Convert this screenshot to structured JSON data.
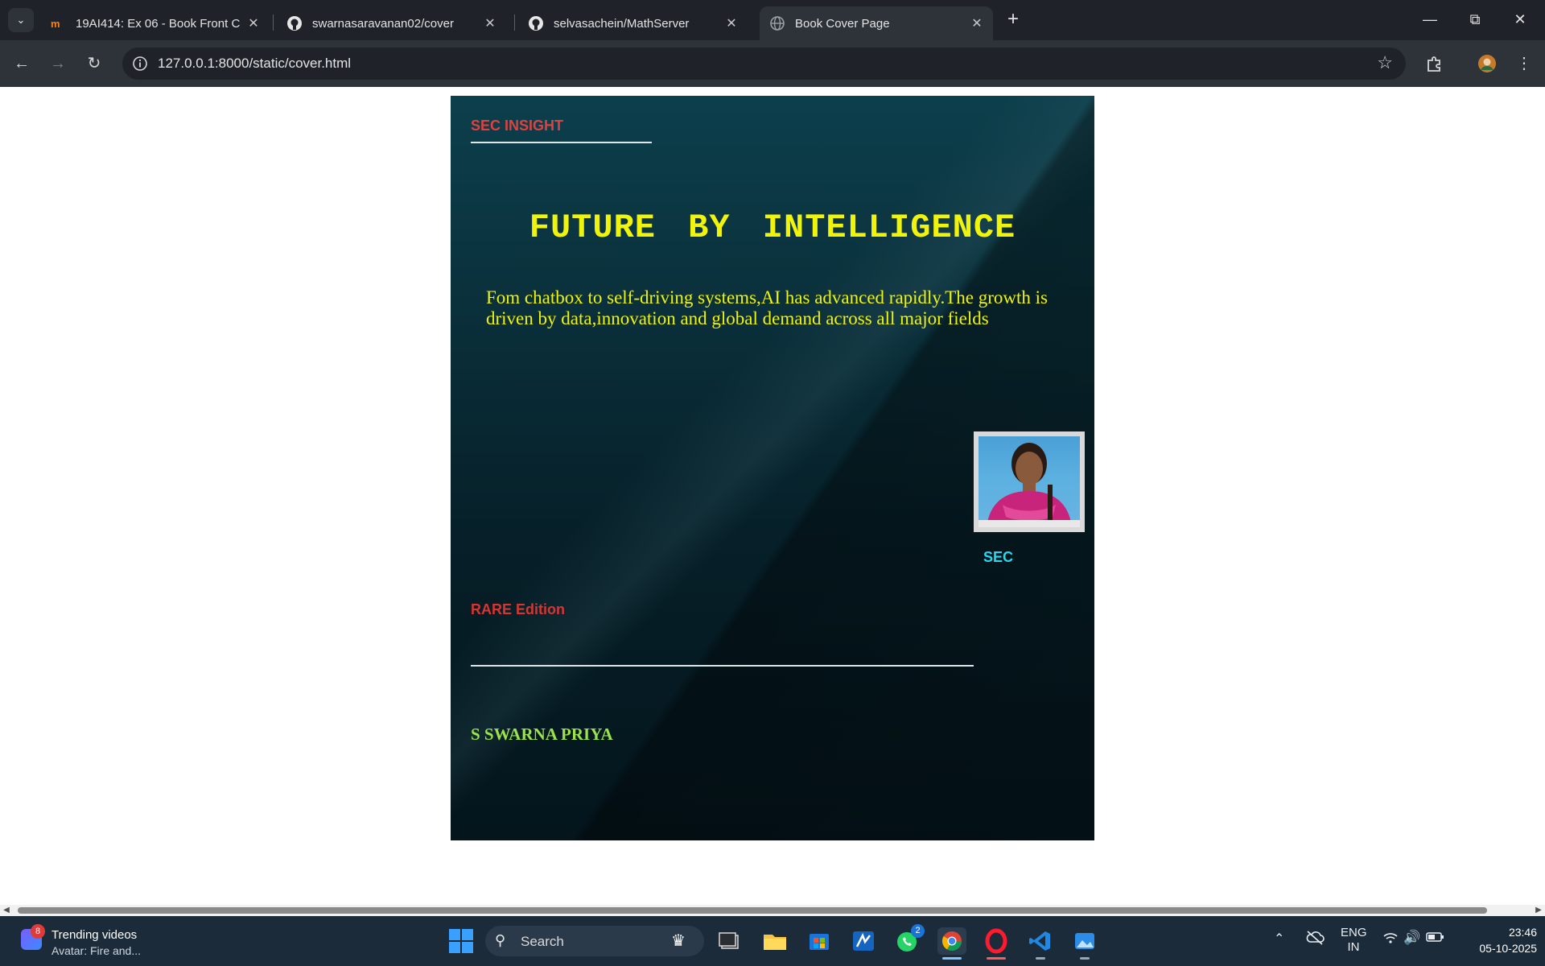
{
  "browser": {
    "tabs": [
      {
        "title": "19AI414: Ex 06 - Book Front Co",
        "active": false
      },
      {
        "title": "swarnasaravanan02/cover",
        "active": false
      },
      {
        "title": "selvasachein/MathServer",
        "active": false
      },
      {
        "title": "Book Cover Page",
        "active": true
      }
    ],
    "url": "127.0.0.1:8000/static/cover.html"
  },
  "cover": {
    "brand": "SEC INSIGHT",
    "title": "FUTURE BY INTELLIGENCE",
    "description": "Fom chatbox to self-driving systems,AI has advanced rapidly.The growth is driven by data,innovation and global demand across all major fields",
    "photo_caption": "SEC",
    "edition": "RARE Edition",
    "author": "S SWARNA PRIYA"
  },
  "taskbar": {
    "widget_badge": "8",
    "widget_title": "Trending videos",
    "widget_subtitle": "Avatar: Fire and...",
    "search_placeholder": "Search",
    "whatsapp_badge": "2",
    "language": "ENG",
    "region": "IN",
    "time": "23:46",
    "date": "05-10-2025"
  },
  "colors": {
    "brand": "#e0413f",
    "title": "#f0f30a",
    "caption": "#27d8f0",
    "edition": "#d63632",
    "author": "#9be34a"
  }
}
